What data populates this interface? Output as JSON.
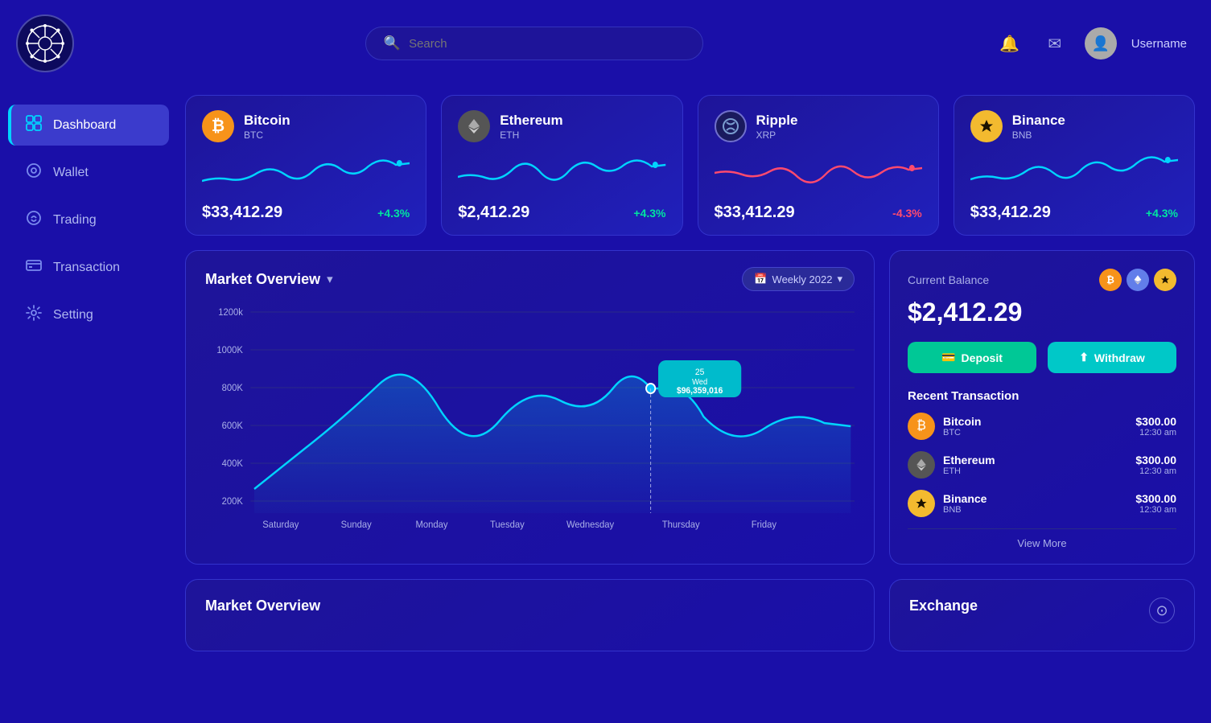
{
  "header": {
    "search_placeholder": "Search",
    "username": "Username"
  },
  "sidebar": {
    "items": [
      {
        "id": "dashboard",
        "label": "Dashboard",
        "icon": "⊞",
        "active": true
      },
      {
        "id": "wallet",
        "label": "Wallet",
        "icon": "◉",
        "active": false
      },
      {
        "id": "trading",
        "label": "Trading",
        "icon": "↻",
        "active": false
      },
      {
        "id": "transaction",
        "label": "Transaction",
        "icon": "▬",
        "active": false
      },
      {
        "id": "setting",
        "label": "Setting",
        "icon": "⚙",
        "active": false
      }
    ]
  },
  "crypto_cards": [
    {
      "name": "Bitcoin",
      "symbol": "BTC",
      "price": "$33,412.29",
      "change": "+4.3%",
      "positive": true,
      "color": "#f7931a"
    },
    {
      "name": "Ethereum",
      "symbol": "ETH",
      "price": "$2,412.29",
      "change": "+4.3%",
      "positive": true,
      "color": "#627eea"
    },
    {
      "name": "Ripple",
      "symbol": "XRP",
      "price": "$33,412.29",
      "change": "-4.3%",
      "positive": false,
      "color": "#346aa9"
    },
    {
      "name": "Binance",
      "symbol": "BNB",
      "price": "$33,412.29",
      "change": "+4.3%",
      "positive": true,
      "color": "#f3ba2f"
    }
  ],
  "market_overview": {
    "title": "Market Overview",
    "period": "Weekly 2022",
    "tooltip_day": "25",
    "tooltip_weekday": "Wed",
    "tooltip_value": "$96,359,016",
    "y_labels": [
      "1200k",
      "1000K",
      "800K",
      "600K",
      "400K",
      "200K"
    ],
    "x_labels": [
      "Saturday",
      "Sunday",
      "Monday",
      "Tuesday",
      "Wednesday",
      "Thursday",
      "Friday"
    ]
  },
  "balance_card": {
    "label": "Current Balance",
    "amount": "$2,412.29",
    "deposit_label": "Deposit",
    "withdraw_label": "Withdraw",
    "recent_tx_label": "Recent Transaction",
    "transactions": [
      {
        "name": "Bitcoin",
        "symbol": "BTC",
        "amount": "$300.00",
        "time": "12:30 am",
        "color": "#f7931a"
      },
      {
        "name": "Ethereum",
        "symbol": "ETH",
        "amount": "$300.00",
        "time": "12:30 am",
        "color": "#627eea"
      },
      {
        "name": "Binance",
        "symbol": "BNB",
        "amount": "$300.00",
        "time": "12:30 am",
        "color": "#f3ba2f"
      }
    ],
    "view_more_label": "View More"
  },
  "bottom": {
    "market_overview_label": "Market Overview",
    "exchange_label": "Exchange"
  }
}
